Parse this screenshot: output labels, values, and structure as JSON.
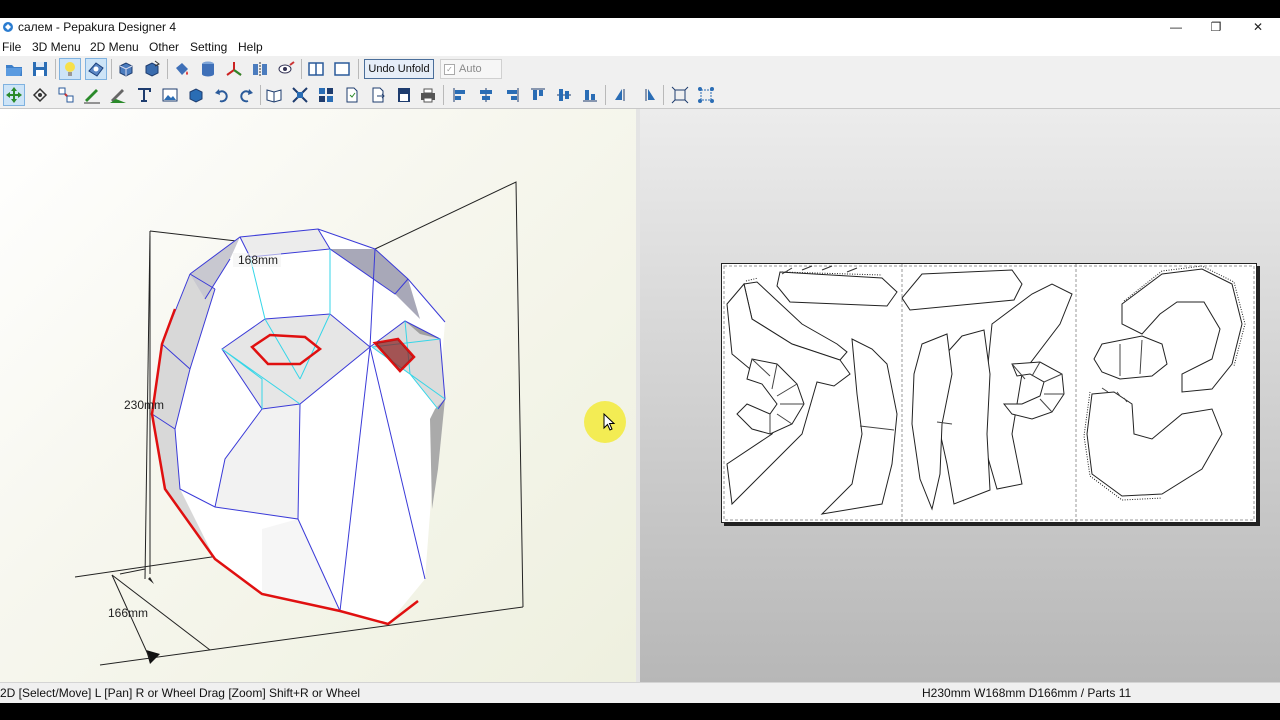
{
  "window": {
    "title": "салем - Pepakura Designer 4",
    "minimize_glyph": "—",
    "maximize_glyph": "❐",
    "close_glyph": "✕"
  },
  "menu": {
    "items": [
      "File",
      "3D Menu",
      "2D Menu",
      "Other",
      "Setting",
      "Help"
    ]
  },
  "toolbar": {
    "undo_unfold_label": "Undo Unfold",
    "auto_label": "Auto",
    "auto_checked": true,
    "auto_enabled": false
  },
  "view3d": {
    "width_label": "168mm",
    "height_label": "230mm",
    "depth_label": "166mm"
  },
  "status": {
    "left": "2D [Select/Move] L [Pan] R or Wheel Drag [Zoom] Shift+R or Wheel",
    "right": "H230mm W168mm D166mm / Parts 11"
  },
  "colors": {
    "cut_edge": "#e01010",
    "fold_edge": "#3a3ad8",
    "cyan_edge": "#36d6e8",
    "cursor_highlight": "#f3ea3a",
    "selected_tool": "#cde4f7"
  },
  "icons": {
    "toolbar1": [
      "open-icon",
      "save-icon",
      "lightbulb-icon",
      "faces-icon",
      "cube-rotate-icon",
      "cube-flip-icon",
      "paint-bucket-icon",
      "cylinder-icon",
      "axes-icon",
      "mirror-icon",
      "eye-link-icon",
      "split-view-icon",
      "single-view-icon"
    ],
    "toolbar2": [
      "select-move-icon",
      "rotate-icon",
      "join-parts-icon",
      "edit-line-icon",
      "edit-flap-icon",
      "text-icon",
      "image-icon",
      "box-icon",
      "undo-icon",
      "redo-icon",
      "book-icon",
      "arrange-icon",
      "layout-icon",
      "page-icon",
      "page-export-icon",
      "save-page-icon",
      "print-icon",
      "align-left-icon",
      "align-center-icon",
      "align-right-icon",
      "align-top-icon",
      "align-middle-icon",
      "align-bottom-icon",
      "distribute-h-icon",
      "distribute-v-icon",
      "fit-icon",
      "scatter-icon"
    ]
  }
}
